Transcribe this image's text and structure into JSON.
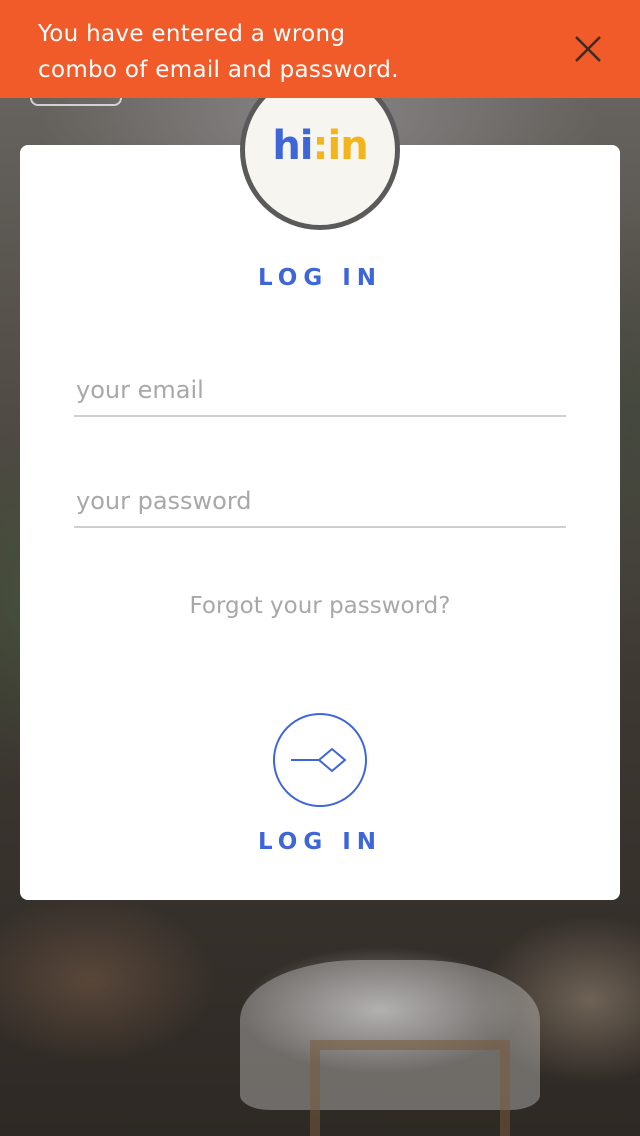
{
  "error_banner": {
    "message_line1": "You have entered a wrong",
    "message_line2": "combo of email and password.",
    "close_icon": "close-icon",
    "color": "#f15a29"
  },
  "logo": {
    "hi": "hi",
    "colon": ":",
    "in": "in",
    "primary_color": "#3f66d9",
    "accent_color": "#f4b51c"
  },
  "login_form": {
    "title": "LOG IN",
    "email_placeholder": "your email",
    "email_value": "",
    "password_placeholder": "your password",
    "password_value": "",
    "forgot_password": "Forgot your password?",
    "submit_icon": "arrow-diamond-icon",
    "submit_label": "LOG IN"
  }
}
